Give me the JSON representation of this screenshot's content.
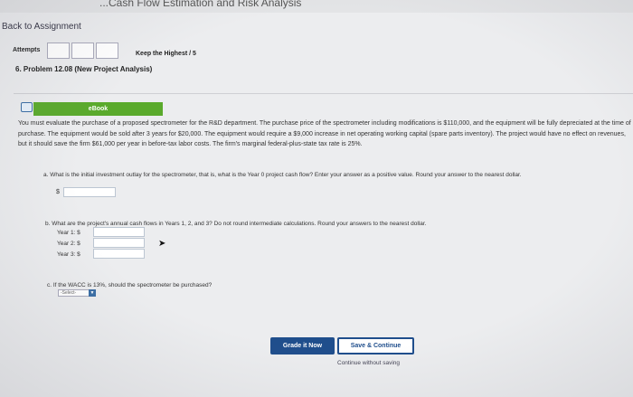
{
  "header": {
    "title": "...Cash Flow Estimation and Risk Analysis",
    "back_link": "Back to Assignment"
  },
  "attempts": {
    "label": "Attempts",
    "keep_highest": "Keep the Highest / 5"
  },
  "problem": {
    "title": "6. Problem 12.08 (New Project Analysis)",
    "ebook_label": "eBook",
    "description": "You must evaluate the purchase of a proposed spectrometer for the R&D department. The purchase price of the spectrometer including modifications is $110,000, and the equipment will be fully depreciated at the time of purchase. The equipment would be sold after 3 years for $20,000. The equipment would require a $9,000 increase in net operating working capital (spare parts inventory). The project would have no effect on revenues, but it should save the firm $61,000 per year in before-tax labor costs. The firm's marginal federal-plus-state tax rate is 25%."
  },
  "questions": {
    "a": {
      "text": "a. What is the initial investment outlay for the spectrometer, that is, what is the Year 0 project cash flow? Enter your answer as a positive value. Round your answer to the nearest dollar.",
      "currency": "$",
      "value": ""
    },
    "b": {
      "text": "b. What are the project's annual cash flows in Years 1, 2, and 3? Do not round intermediate calculations. Round your answers to the nearest dollar.",
      "year1_label": "Year 1: $",
      "year2_label": "Year 2: $",
      "year3_label": "Year 3: $"
    },
    "c": {
      "text": "c. If the WACC is 13%, should the spectrometer be purchased?",
      "select_value": "-Select-"
    }
  },
  "actions": {
    "grade_now": "Grade it Now",
    "save_continue": "Save & Continue",
    "continue_without_saving": "Continue without saving"
  }
}
